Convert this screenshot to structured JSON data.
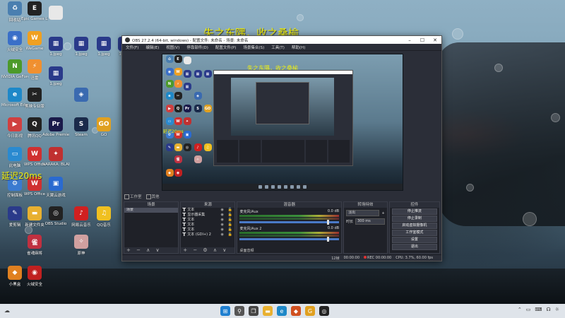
{
  "overlay": {
    "top_text": "失之东隅，收之桑榆",
    "latency_text": "延迟20ms"
  },
  "desktop_icons": [
    {
      "label": "回收站",
      "icon": "recycle-bin-icon",
      "color": "#4a7fb0",
      "glyph": "♻"
    },
    {
      "label": "Epic Games Launcher",
      "icon": "epic-games-icon",
      "color": "#222",
      "glyph": "E"
    },
    {
      "label": "",
      "icon": "file-icon",
      "color": "#e8e8e8",
      "glyph": ""
    },
    {
      "label": "火绒安全",
      "icon": "security-icon",
      "color": "#3a6fc8",
      "glyph": "◉"
    },
    {
      "label": "WeGame",
      "icon": "wegame-icon",
      "color": "#f0a020",
      "glyph": "W"
    },
    {
      "label": "1.jpeg",
      "icon": "image-file-icon",
      "color": "#2a3a8a",
      "glyph": "▦"
    },
    {
      "label": "1.jpeg",
      "icon": "image-file-icon",
      "color": "#2a3a8a",
      "glyph": "▦"
    },
    {
      "label": "1.jpeg",
      "icon": "image-file-icon",
      "color": "#2a3a8a",
      "glyph": "▦"
    },
    {
      "label": "1.jpeg",
      "icon": "image-file-icon",
      "color": "#2a3a8a",
      "glyph": "▦"
    },
    {
      "label": "NVIDIA GeForce Experience",
      "icon": "nvidia-icon",
      "color": "#4c9a2a",
      "glyph": "N"
    },
    {
      "label": "迅雷",
      "icon": "thunder-icon",
      "color": "#f09030",
      "glyph": "⚡"
    },
    {
      "label": "1.jpeg",
      "icon": "image-file-icon",
      "color": "#2a3a8a",
      "glyph": "▦"
    },
    {
      "label": "Microsoft Edge",
      "icon": "edge-icon",
      "color": "#1e88c8",
      "glyph": "e"
    },
    {
      "label": "剪映专业版",
      "icon": "capcut-icon",
      "color": "#222",
      "glyph": "✂"
    },
    {
      "label": "",
      "icon": "app-icon",
      "color": "#3a6ab0",
      "glyph": "◈"
    },
    {
      "label": "今日影视",
      "icon": "video-app-icon",
      "color": "#d04040",
      "glyph": "▶"
    },
    {
      "label": "腾讯QQ",
      "icon": "qq-icon",
      "color": "#222",
      "glyph": "Q"
    },
    {
      "label": "Adobe Premiere",
      "icon": "premiere-icon",
      "color": "#1a1a4a",
      "glyph": "Pr"
    },
    {
      "label": "Steam",
      "icon": "steam-icon",
      "color": "#1a2a4a",
      "glyph": "S"
    },
    {
      "label": "GO",
      "icon": "go-icon",
      "color": "#e0a020",
      "glyph": "GO"
    },
    {
      "label": "此电脑",
      "icon": "this-pc-icon",
      "color": "#2a8ad0",
      "glyph": "▭"
    },
    {
      "label": "WPS Office",
      "icon": "wps-icon",
      "color": "#d03030",
      "glyph": "W"
    },
    {
      "label": "NARAKA: BLADEPOINT",
      "icon": "naraka-icon",
      "color": "#c03030",
      "glyph": "✦"
    },
    {
      "label": "控制面板",
      "icon": "control-panel-icon",
      "color": "#3a7ad0",
      "glyph": "⚙"
    },
    {
      "label": "WPS Office",
      "icon": "wps-icon",
      "color": "#d03030",
      "glyph": "W"
    },
    {
      "label": "天翼云游戏",
      "icon": "cloud-game-icon",
      "color": "#2a6ad0",
      "glyph": "▣"
    },
    {
      "label": "爱剪辑",
      "icon": "editor-icon",
      "color": "#2a3a8a",
      "glyph": "✎"
    },
    {
      "label": "新建文件夹",
      "icon": "folder-icon",
      "color": "#e8b030",
      "glyph": "▬"
    },
    {
      "label": "OBS Studio",
      "icon": "obs-icon",
      "color": "#222",
      "glyph": "◎"
    },
    {
      "label": "网易云音乐",
      "icon": "netease-music-icon",
      "color": "#d02020",
      "glyph": "♪"
    },
    {
      "label": "QQ音乐",
      "icon": "qq-music-icon",
      "color": "#f0c020",
      "glyph": "♫"
    },
    {
      "label": "雀魂麻将",
      "icon": "mahjong-icon",
      "color": "#c03040",
      "glyph": "雀"
    },
    {
      "label": "原神",
      "icon": "genshin-icon",
      "color": "#d0a0a0",
      "glyph": "✧"
    },
    {
      "label": "小黑盒",
      "icon": "box-icon",
      "color": "#e08020",
      "glyph": "◆"
    },
    {
      "label": "火绒安全",
      "icon": "security-icon",
      "color": "#c02020",
      "glyph": "◉"
    }
  ],
  "obs": {
    "title": "OBS 27.2.4 (64-bit, windows) - 配置文件: 未命名 - 场景: 未命名",
    "menu": [
      "文件(F)",
      "编辑(E)",
      "视图(V)",
      "停靠部件(D)",
      "配置文件(P)",
      "场景集合(S)",
      "工具(T)",
      "帮助(H)"
    ],
    "scenebar": {
      "studio_mode": "工作室",
      "other": "其他"
    },
    "docks": {
      "scenes": {
        "title": "场景",
        "items": [
          "场景"
        ]
      },
      "sources": {
        "title": "来源",
        "items": [
          "文本",
          "显示器采集",
          "文本",
          "文本",
          "文本",
          "文本 (GDI+) 2"
        ]
      },
      "mixer": {
        "title": "混音器",
        "channels": [
          {
            "name": "麦克风/Aux",
            "db": "0.0 dB"
          },
          {
            "name": "麦克风/Aux 2",
            "db": "0.0 dB"
          }
        ],
        "footer": "桌面音频"
      },
      "transitions": {
        "title": "转场特效",
        "type": "淡出",
        "duration_label": "时长",
        "duration": "300 ms"
      },
      "controls": {
        "title": "控件",
        "buttons": [
          "停止推流",
          "停止录制",
          "启动虚拟摄像机",
          "工作室模式",
          "设置",
          "退出"
        ]
      }
    },
    "status": {
      "dropped": "12帧",
      "live_time": "00:00:00",
      "rec_label": "REC",
      "rec_time": "00:00:00",
      "cpu": "CPU: 3.7%, 60.00 fps"
    }
  },
  "taskbar": {
    "weather": "☁",
    "apps": [
      {
        "name": "start-icon",
        "glyph": "⊞",
        "color": "#1e7fd0"
      },
      {
        "name": "search-icon",
        "glyph": "⚲",
        "color": "#555"
      },
      {
        "name": "task-view-icon",
        "glyph": "❐",
        "color": "#444"
      },
      {
        "name": "file-explorer-icon",
        "glyph": "▬",
        "color": "#e8b030"
      },
      {
        "name": "edge-icon",
        "glyph": "e",
        "color": "#1e88c8"
      },
      {
        "name": "game-icon",
        "glyph": "◆",
        "color": "#d05020"
      },
      {
        "name": "go-icon",
        "glyph": "G",
        "color": "#e0a020"
      },
      {
        "name": "obs-icon",
        "glyph": "◎",
        "color": "#222"
      }
    ],
    "tray": [
      "⌃",
      "▭",
      "⌨",
      "☊",
      "☼"
    ]
  }
}
